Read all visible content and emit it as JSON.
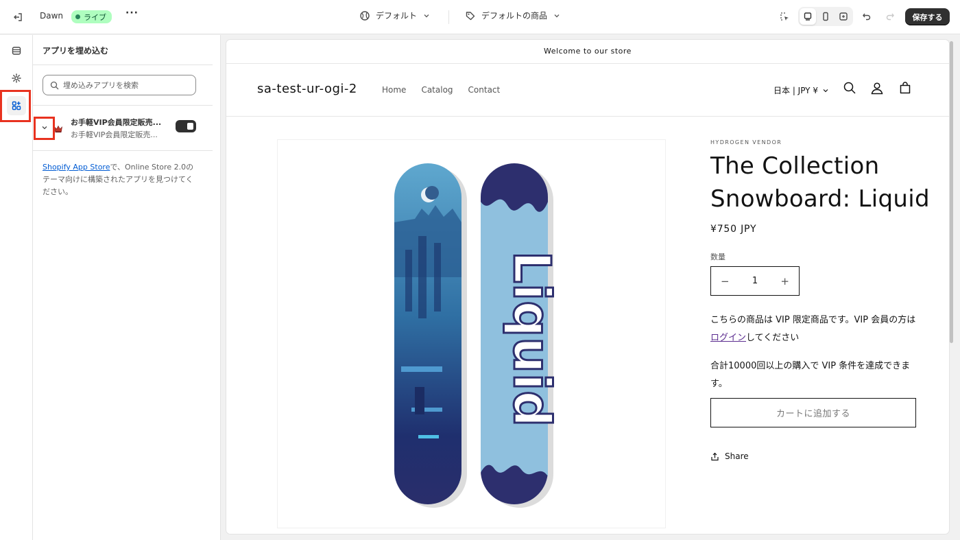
{
  "topbar": {
    "theme_name": "Dawn",
    "live_label": "ライブ",
    "more_label": "···",
    "template_selector": "デフォルト",
    "product_selector": "デフォルトの商品",
    "save_label": "保存する"
  },
  "sidebar_panel": {
    "title": "アプリを埋め込む",
    "search_placeholder": "埋め込みアプリを検索",
    "app": {
      "name": "お手軽VIP会員限定販売...",
      "subtitle": "お手軽VIP会員限定販売...",
      "enabled": true
    },
    "help_link": "Shopify App Store",
    "help_text": "で、Online Store 2.0のテーマ向けに構築されたアプリを見つけてください。"
  },
  "preview": {
    "announcement": "Welcome to our store",
    "store_name": "sa-test-ur-ogi-2",
    "nav": [
      "Home",
      "Catalog",
      "Contact"
    ],
    "locale": "日本 | JPY ¥",
    "vendor": "HYDROGEN VENDOR",
    "product_title": "The Collection Snowboard: Liquid",
    "price": "¥750 JPY",
    "quantity_label": "数量",
    "quantity_value": "1",
    "vip_text_before": "こちらの商品は VIP 限定商品です。VIP 会員の方は",
    "vip_link": "ログイン",
    "vip_text_after": "してください",
    "vip_condition": "合計10000回以上の購入で VIP 条件を達成できます。",
    "add_to_cart": "カートに追加する",
    "share": "Share"
  },
  "colors": {
    "highlight": "#e8321f",
    "live_badge": "#affebf",
    "save_button": "#303030"
  }
}
